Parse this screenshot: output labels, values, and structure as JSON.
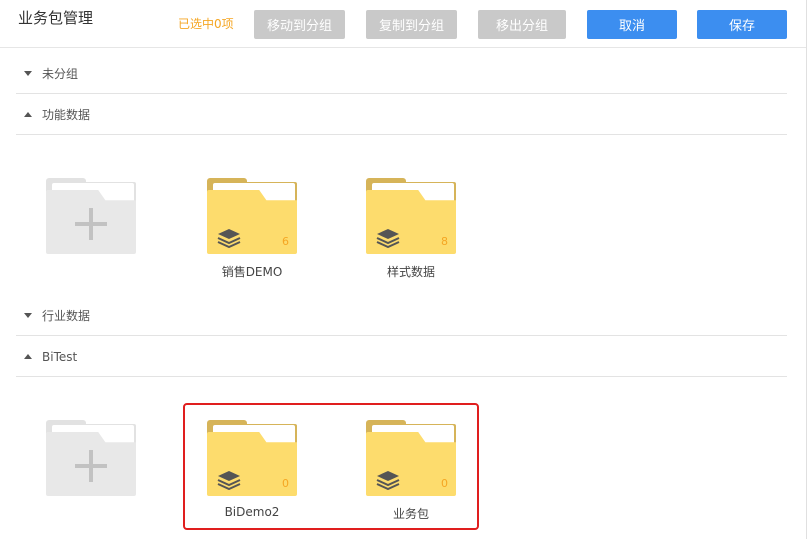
{
  "header": {
    "title": "业务包管理",
    "selected_count": "已选中0项",
    "buttons": {
      "move_to_group": "移动到分组",
      "copy_to_group": "复制到分组",
      "remove_from_group": "移出分组",
      "cancel": "取消",
      "save": "保存"
    }
  },
  "groups": [
    {
      "label": "未分组",
      "expanded": false,
      "packages": []
    },
    {
      "label": "功能数据",
      "expanded": true,
      "packages": [
        {
          "name": "销售DEMO",
          "count": "6"
        },
        {
          "name": "样式数据",
          "count": "8"
        }
      ]
    },
    {
      "label": "行业数据",
      "expanded": false,
      "packages": []
    },
    {
      "label": "BiTest",
      "expanded": true,
      "packages": [
        {
          "name": "BiDemo2",
          "count": "0"
        },
        {
          "name": "业务包",
          "count": "0"
        }
      ]
    }
  ],
  "colors": {
    "accent": "#3c8ef0",
    "disabled_button": "#c9c9c9",
    "count_text": "#f5a623",
    "folder_front": "#fddc6d",
    "folder_back": "#d6b459",
    "highlight_box": "#e01e1e"
  },
  "icons": {
    "add": "plus-icon",
    "package": "layers-icon",
    "collapsed": "caret-down-icon",
    "expanded": "caret-up-icon"
  }
}
